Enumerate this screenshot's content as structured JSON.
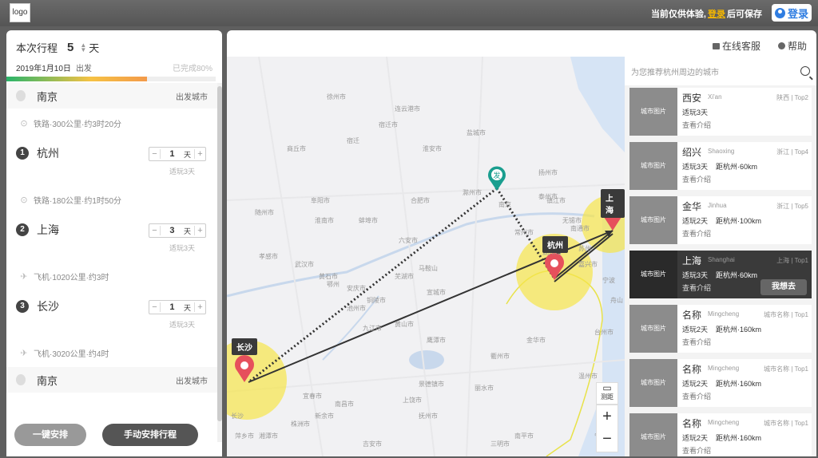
{
  "header": {
    "logo_text": "logo",
    "notice_prefix": "当前仅供体验,",
    "notice_login": "登录",
    "notice_suffix": "后可保存",
    "login_button": "登录"
  },
  "trip": {
    "title": "本次行程",
    "days": "5",
    "days_unit": "天",
    "date": "2019年1月10日",
    "depart": "出发",
    "completion": "已完成80%",
    "progress_fraction": 0.8,
    "origin": {
      "name": "南京",
      "tag": "出发城市"
    },
    "legs": [
      {
        "text": "铁路·300公里·约3时20分"
      },
      {
        "text": "铁路·180公里·约1时50分"
      },
      {
        "text": "飞机·1020公里·约3时"
      },
      {
        "text": "飞机·3020公里·约4时"
      }
    ],
    "stops": [
      {
        "idx": "1",
        "name": "杭州",
        "days": "1",
        "unit": "天",
        "suggest": "适玩3天"
      },
      {
        "idx": "2",
        "name": "上海",
        "days": "3",
        "unit": "天",
        "suggest": "适玩3天"
      },
      {
        "idx": "3",
        "name": "长沙",
        "days": "1",
        "unit": "天",
        "suggest": "适玩3天"
      }
    ],
    "destination": {
      "name": "南京",
      "tag": "出发城市"
    },
    "auto_button": "一键安排",
    "manual_button": "手动安排行程"
  },
  "tools": {
    "service": "在线客服",
    "help": "帮助"
  },
  "map": {
    "markers": [
      "发",
      "杭州",
      "上海",
      "长沙"
    ],
    "ruler_label": "测距",
    "zoom_in": "+",
    "zoom_out": "−",
    "place_names": [
      "徐州市",
      "连云港市",
      "宿迁市",
      "宿迁",
      "淮安市",
      "盐城市",
      "商丘市",
      "阜阳市",
      "淮南市",
      "蚌埠市",
      "滁州市",
      "扬州市",
      "泰州市",
      "南通市",
      "合肥市",
      "六安市",
      "南京",
      "镇江市",
      "常州市",
      "无锡市",
      "苏州",
      "湖州市",
      "嘉兴市",
      "安庆市",
      "池州市",
      "铜陵市",
      "芜湖市",
      "马鞍山",
      "黄山市",
      "宣城市",
      "武汉市",
      "黄石市",
      "孝感市",
      "九江市",
      "鄂州",
      "随州市",
      "景德镇市",
      "衢州市",
      "金华市",
      "上饶市",
      "南昌市",
      "丽水市",
      "温州市",
      "台州市",
      "宁波",
      "舟山",
      "鹰潭市",
      "抚州市",
      "吉安市",
      "萍乡市",
      "湘潭市",
      "株洲市",
      "长沙",
      "宜春市",
      "新余市",
      "福州市",
      "宁德市",
      "南平市",
      "三明市"
    ]
  },
  "panel": {
    "search_placeholder": "为您推荐杭州周边的城市",
    "cards": [
      {
        "img": "城市图片",
        "name": "西安",
        "pinyin": "Xi'an",
        "rank": "陕西 | Top2",
        "time": "适玩3天",
        "dist": "",
        "more": "查看介绍"
      },
      {
        "img": "城市图片",
        "name": "绍兴",
        "pinyin": "Shaoxing",
        "rank": "浙江 | Top4",
        "time": "适玩3天",
        "dist": "距杭州·60km",
        "more": "查看介绍"
      },
      {
        "img": "城市图片",
        "name": "金华",
        "pinyin": "Jinhua",
        "rank": "浙江 | Top5",
        "time": "适玩2天",
        "dist": "距杭州·100km",
        "more": "查看介绍"
      },
      {
        "img": "城市图片",
        "name": "上海",
        "pinyin": "Shanghai",
        "rank": "上海 | Top1",
        "time": "适玩3天",
        "dist": "距杭州·60km",
        "more": "查看介绍",
        "action": "我想去"
      },
      {
        "img": "城市图片",
        "name": "名称",
        "pinyin": "Mingcheng",
        "rank": "城市名称 | Top1",
        "time": "适玩2天",
        "dist": "距杭州·160km",
        "more": "查看介绍"
      },
      {
        "img": "城市图片",
        "name": "名称",
        "pinyin": "Mingcheng",
        "rank": "城市名称 | Top1",
        "time": "适玩2天",
        "dist": "距杭州·160km",
        "more": "查看介绍"
      },
      {
        "img": "城市图片",
        "name": "名称",
        "pinyin": "Mingcheng",
        "rank": "城市名称 | Top1",
        "time": "适玩2天",
        "dist": "距杭州·160km",
        "more": "查看介绍"
      }
    ]
  }
}
